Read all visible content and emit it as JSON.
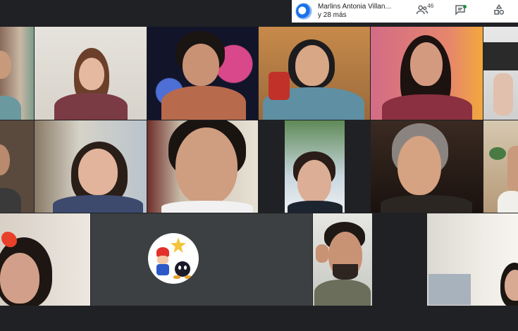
{
  "presenter": {
    "name": "Marlins Antonia Villan...",
    "others": "y 28 más"
  },
  "toolbar": {
    "participants_count": "46",
    "participants_icon": "people-icon",
    "chat_icon": "chat-icon",
    "activities_icon": "shapes-icon"
  },
  "colors": {
    "background": "#202124",
    "tile": "#3c4043",
    "toolbar": "#ffffff"
  }
}
